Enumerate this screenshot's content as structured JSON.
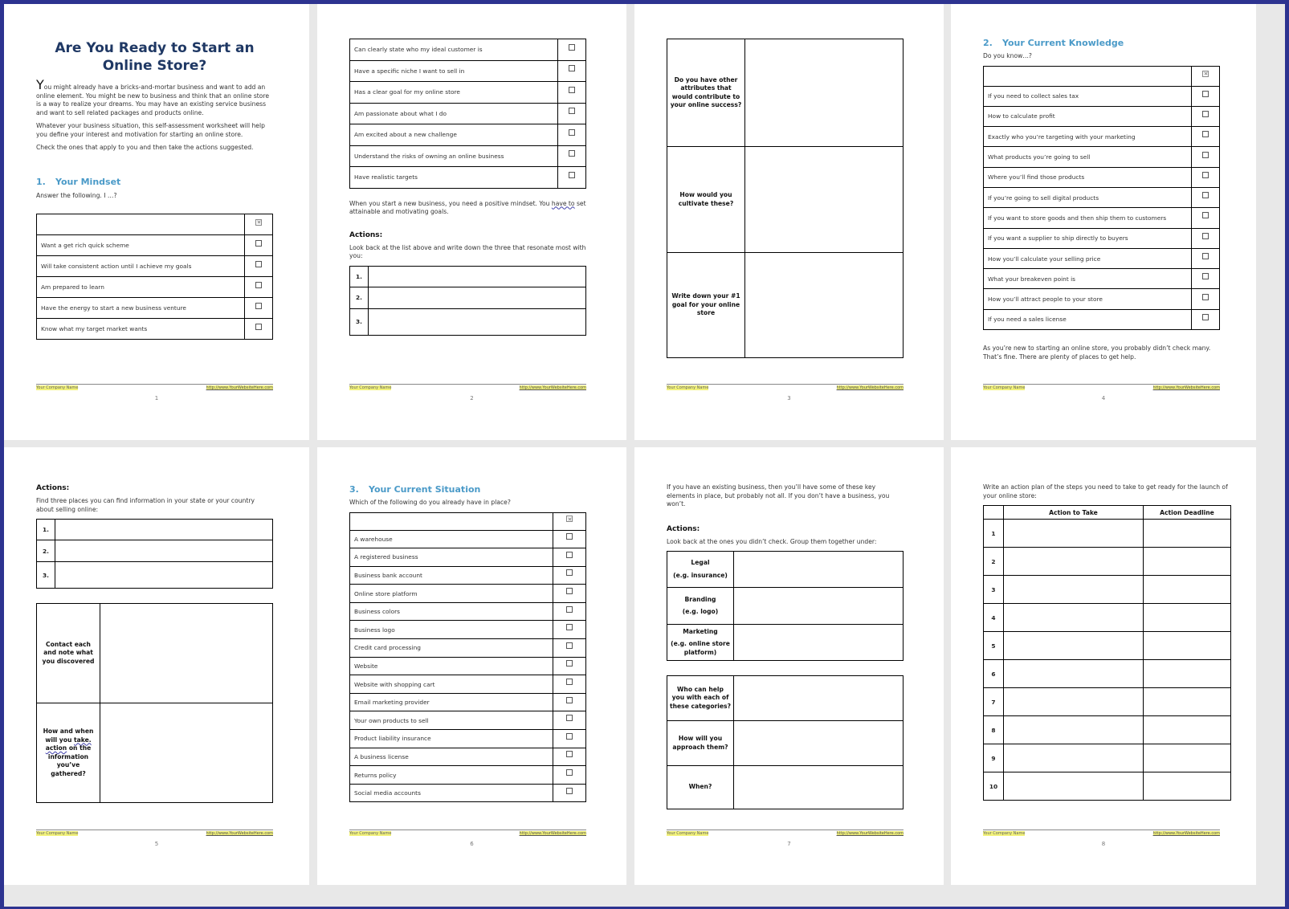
{
  "footer": {
    "company": "Your Company Name",
    "url": "http://www.YourWebsiteHere.com"
  },
  "page1": {
    "title": "Are You Ready to Start an Online Store?",
    "intro_dropcap": "Y",
    "intro": "ou might already have a bricks-and-mortar business and want to add an online element.  You might be new to business and think that an online store is a way to realize your dreams. You may have an existing service business and want to sell related packages and products online.",
    "para2": "Whatever your business situation, this self-assessment worksheet will help you define your interest and motivation for starting an online store.",
    "para3": "Check the ones that apply to you and then take the actions suggested.",
    "section_num": "1.",
    "section_title": "Your Mindset",
    "prompt": "Answer the following. I …?",
    "items": [
      "Want a get rich quick scheme",
      "Will take consistent action until I achieve my goals",
      "Am prepared to learn",
      "Have the energy to start a new business venture",
      "Know what my target market wants"
    ],
    "page_number": "1"
  },
  "page2": {
    "items": [
      "Can clearly state who my ideal customer is",
      "Have a specific niche I want to sell in",
      "Has a clear goal for my online store",
      "Am passionate about what I do",
      "Am excited about a new challenge",
      "Understand the risks of owning an online business",
      "Have realistic targets"
    ],
    "note_before": "When you start a new business, you need a positive mindset. You ",
    "note_flag": "have to",
    "note_after": " set attainable and motivating goals.",
    "actions_heading": "Actions:",
    "actions_text": "Look back at the list above and write down the three that resonate most with you:",
    "numbers": [
      "1.",
      "2.",
      "3."
    ],
    "page_number": "2"
  },
  "page3": {
    "questions": [
      "Do you have other attributes that would contribute to your online success?",
      "How would you cultivate these?",
      "Write down your #1 goal for your online store"
    ],
    "page_number": "3"
  },
  "page4": {
    "section_num": "2.",
    "section_title": "Your Current Knowledge",
    "prompt": "Do you know…?",
    "items": [
      "If you need to collect sales tax",
      "How to calculate profit",
      "Exactly who you’re targeting with your marketing",
      "What products you’re going to sell",
      "Where you’ll find those products",
      "If you’re going to sell digital products",
      "If you want to store goods and then ship them to customers",
      "If you want a supplier to ship directly to buyers",
      "How you’ll calculate your selling price",
      "What your breakeven point is",
      "How you’ll attract people to your store",
      "If you need a sales license"
    ],
    "note": "As you’re new to starting an online store, you probably didn’t check many. That’s fine. There are plenty of places to get help.",
    "page_number": "4"
  },
  "page5": {
    "actions_heading": "Actions:",
    "actions_text": "Find three places you can find information in your state or your country about selling online:",
    "numbers": [
      "1.",
      "2.",
      "3."
    ],
    "q1": "Contact each and note what you discovered",
    "q2_before": "How and when will you ",
    "q2_flag": "take. action",
    "q2_after": " on the information you’ve gathered?",
    "page_number": "5"
  },
  "page6": {
    "section_num": "3.",
    "section_title": "Your Current Situation",
    "prompt": "Which of the following do you already have in place?",
    "items": [
      "A warehouse",
      "A registered business",
      "Business bank account",
      "Online store platform",
      "Business colors",
      "Business logo",
      "Credit card processing",
      "Website",
      "Website with shopping cart",
      "Email marketing provider",
      "Your own products to sell",
      "Product liability insurance",
      "A business license",
      "Returns policy",
      "Social media accounts"
    ],
    "page_number": "6"
  },
  "page7": {
    "intro": "If you have an existing business, then you’ll have some of these key elements in place, but probably not all. If you don’t have a business, you won’t.",
    "actions_heading": "Actions:",
    "actions_text": "Look back at the ones you didn’t check. Group them together under:",
    "groups": [
      {
        "name": "Legal",
        "example": "(e.g. insurance)"
      },
      {
        "name": "Branding",
        "example": "(e.g. logo)"
      },
      {
        "name": "Marketing",
        "example": "(e.g. online store platform)"
      }
    ],
    "questions": [
      "Who can help you with each of these categories?",
      "How will you approach them?",
      "When?"
    ],
    "page_number": "7"
  },
  "page8": {
    "intro": "Write an action plan of the steps you need to take to get ready for the launch of your online store:",
    "col_action": "Action to Take",
    "col_deadline": "Action Deadline",
    "rows": [
      "1",
      "2",
      "3",
      "4",
      "5",
      "6",
      "7",
      "8",
      "9",
      "10"
    ],
    "page_number": "8"
  }
}
